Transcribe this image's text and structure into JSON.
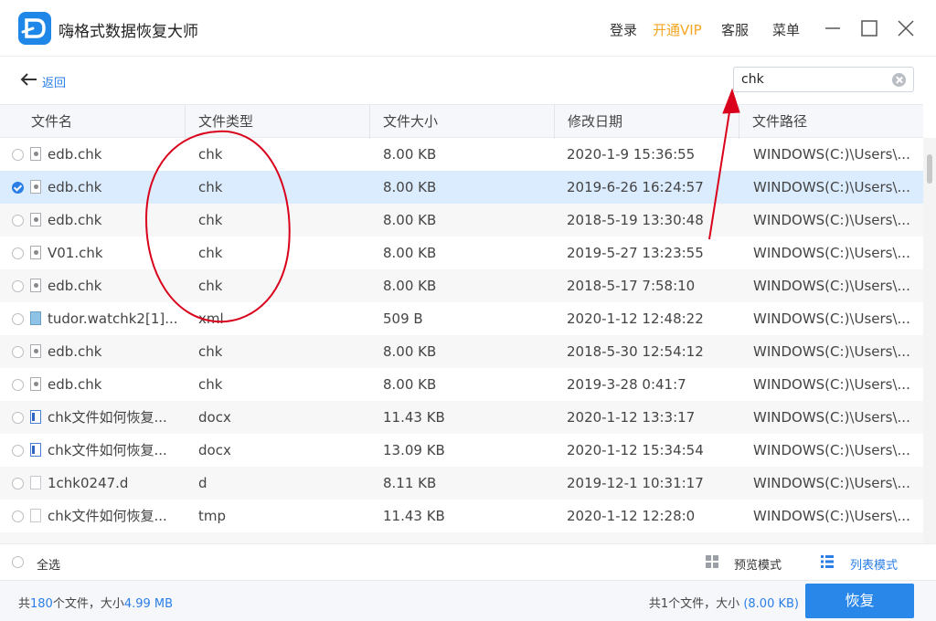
{
  "app": {
    "title": "嗨格式数据恢复大师"
  },
  "header_links": {
    "login": "登录",
    "vip": "开通VIP",
    "service": "客服",
    "menu": "菜单"
  },
  "toolbar": {
    "back_label": "返回",
    "search_value": "chk"
  },
  "columns": [
    "文件名",
    "文件类型",
    "文件大小",
    "修改日期",
    "文件路径"
  ],
  "rows": [
    {
      "name": "edb.chk",
      "type": "chk",
      "size": "8.00 KB",
      "date": "2020-1-9 15:36:55",
      "path": "WINDOWS(C:)\\Users\\...",
      "icon": "system-file-icon",
      "checked": false
    },
    {
      "name": "edb.chk",
      "type": "chk",
      "size": "8.00 KB",
      "date": "2019-6-26 16:24:57",
      "path": "WINDOWS(C:)\\Users\\...",
      "icon": "system-file-icon",
      "checked": true
    },
    {
      "name": "edb.chk",
      "type": "chk",
      "size": "8.00 KB",
      "date": "2018-5-19 13:30:48",
      "path": "WINDOWS(C:)\\Users\\...",
      "icon": "system-file-icon",
      "checked": false
    },
    {
      "name": "V01.chk",
      "type": "chk",
      "size": "8.00 KB",
      "date": "2019-5-27 13:23:55",
      "path": "WINDOWS(C:)\\Users\\...",
      "icon": "system-file-icon",
      "checked": false
    },
    {
      "name": "edb.chk",
      "type": "chk",
      "size": "8.00 KB",
      "date": "2018-5-17 7:58:10",
      "path": "WINDOWS(C:)\\Users\\...",
      "icon": "system-file-icon",
      "checked": false
    },
    {
      "name": "tudor.watchk2[1]...",
      "type": "xml",
      "size": "509 B",
      "date": "2020-1-12 12:48:22",
      "path": "WINDOWS(C:)\\Users\\...",
      "icon": "xml-file-icon",
      "checked": false
    },
    {
      "name": "edb.chk",
      "type": "chk",
      "size": "8.00 KB",
      "date": "2018-5-30 12:54:12",
      "path": "WINDOWS(C:)\\Users\\...",
      "icon": "system-file-icon",
      "checked": false
    },
    {
      "name": "edb.chk",
      "type": "chk",
      "size": "8.00 KB",
      "date": "2019-3-28 0:41:7",
      "path": "WINDOWS(C:)\\Users\\...",
      "icon": "system-file-icon",
      "checked": false
    },
    {
      "name": "chk文件如何恢复...",
      "type": "docx",
      "size": "11.43 KB",
      "date": "2020-1-12 13:3:17",
      "path": "WINDOWS(C:)\\Users\\...",
      "icon": "word-file-icon",
      "checked": false
    },
    {
      "name": "chk文件如何恢复...",
      "type": "docx",
      "size": "13.09 KB",
      "date": "2020-1-12 15:34:54",
      "path": "WINDOWS(C:)\\Users\\...",
      "icon": "word-file-icon",
      "checked": false
    },
    {
      "name": "1chk0247.d",
      "type": "d",
      "size": "8.11 KB",
      "date": "2019-12-1 10:31:17",
      "path": "WINDOWS(C:)\\Users\\...",
      "icon": "blank-file-icon",
      "checked": false
    },
    {
      "name": "chk文件如何恢复...",
      "type": "tmp",
      "size": "11.43 KB",
      "date": "2020-1-12 12:28:0",
      "path": "WINDOWS(C:)\\Users\\...",
      "icon": "blank-file-icon",
      "checked": false
    }
  ],
  "selection_bar": {
    "select_all": "全选",
    "preview_mode": "预览模式",
    "list_mode": "列表模式"
  },
  "status": {
    "total_prefix": "共",
    "total_count": "180",
    "total_mid": "个文件，大小",
    "total_size": "4.99 MB",
    "selected_prefix": "共",
    "selected_count": "1",
    "selected_mid": "个文件，大小",
    "selected_size": "(8.00 KB)"
  },
  "recover_button": "恢复",
  "colors": {
    "accent": "#2a87ea",
    "vip": "#f5a623",
    "annotation": "#d9001b",
    "selected_row": "#dcecff"
  }
}
